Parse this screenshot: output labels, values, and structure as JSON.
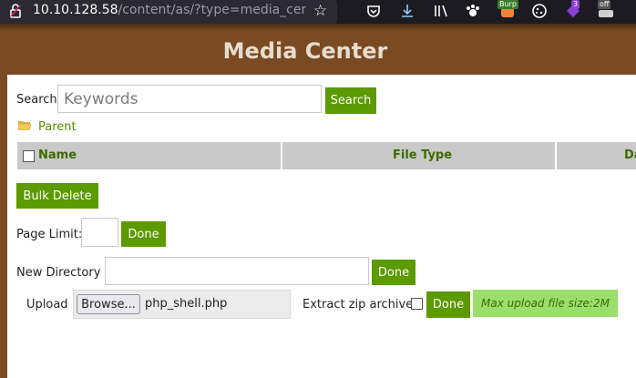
{
  "browser": {
    "url_host": "10.10.128.58",
    "url_path": "/content/as/?type=media_cen",
    "ext_badges": {
      "burp": "Burp",
      "count": "3",
      "off": "off"
    }
  },
  "page": {
    "title": "Media Center"
  },
  "search": {
    "label": "Search",
    "placeholder": "Keywords",
    "button": "Search"
  },
  "nav": {
    "parent_label": "Parent"
  },
  "table": {
    "columns": [
      "Name",
      "File Type",
      "Da"
    ]
  },
  "actions": {
    "bulk_delete": "Bulk Delete"
  },
  "page_limit": {
    "label": "Page Limit:",
    "value": "",
    "button": "Done"
  },
  "new_directory": {
    "label": "New Directory :",
    "value": "",
    "button": "Done"
  },
  "upload": {
    "label": "Upload :",
    "browse_label": "Browse...",
    "file_name": "php_shell.php",
    "extract_label": "Extract zip archive?",
    "button": "Done",
    "max_size": "Max upload file size:2M"
  },
  "colors": {
    "accent": "#5b9a00",
    "background": "#7a4a22",
    "note_bg": "#9ade6b"
  }
}
